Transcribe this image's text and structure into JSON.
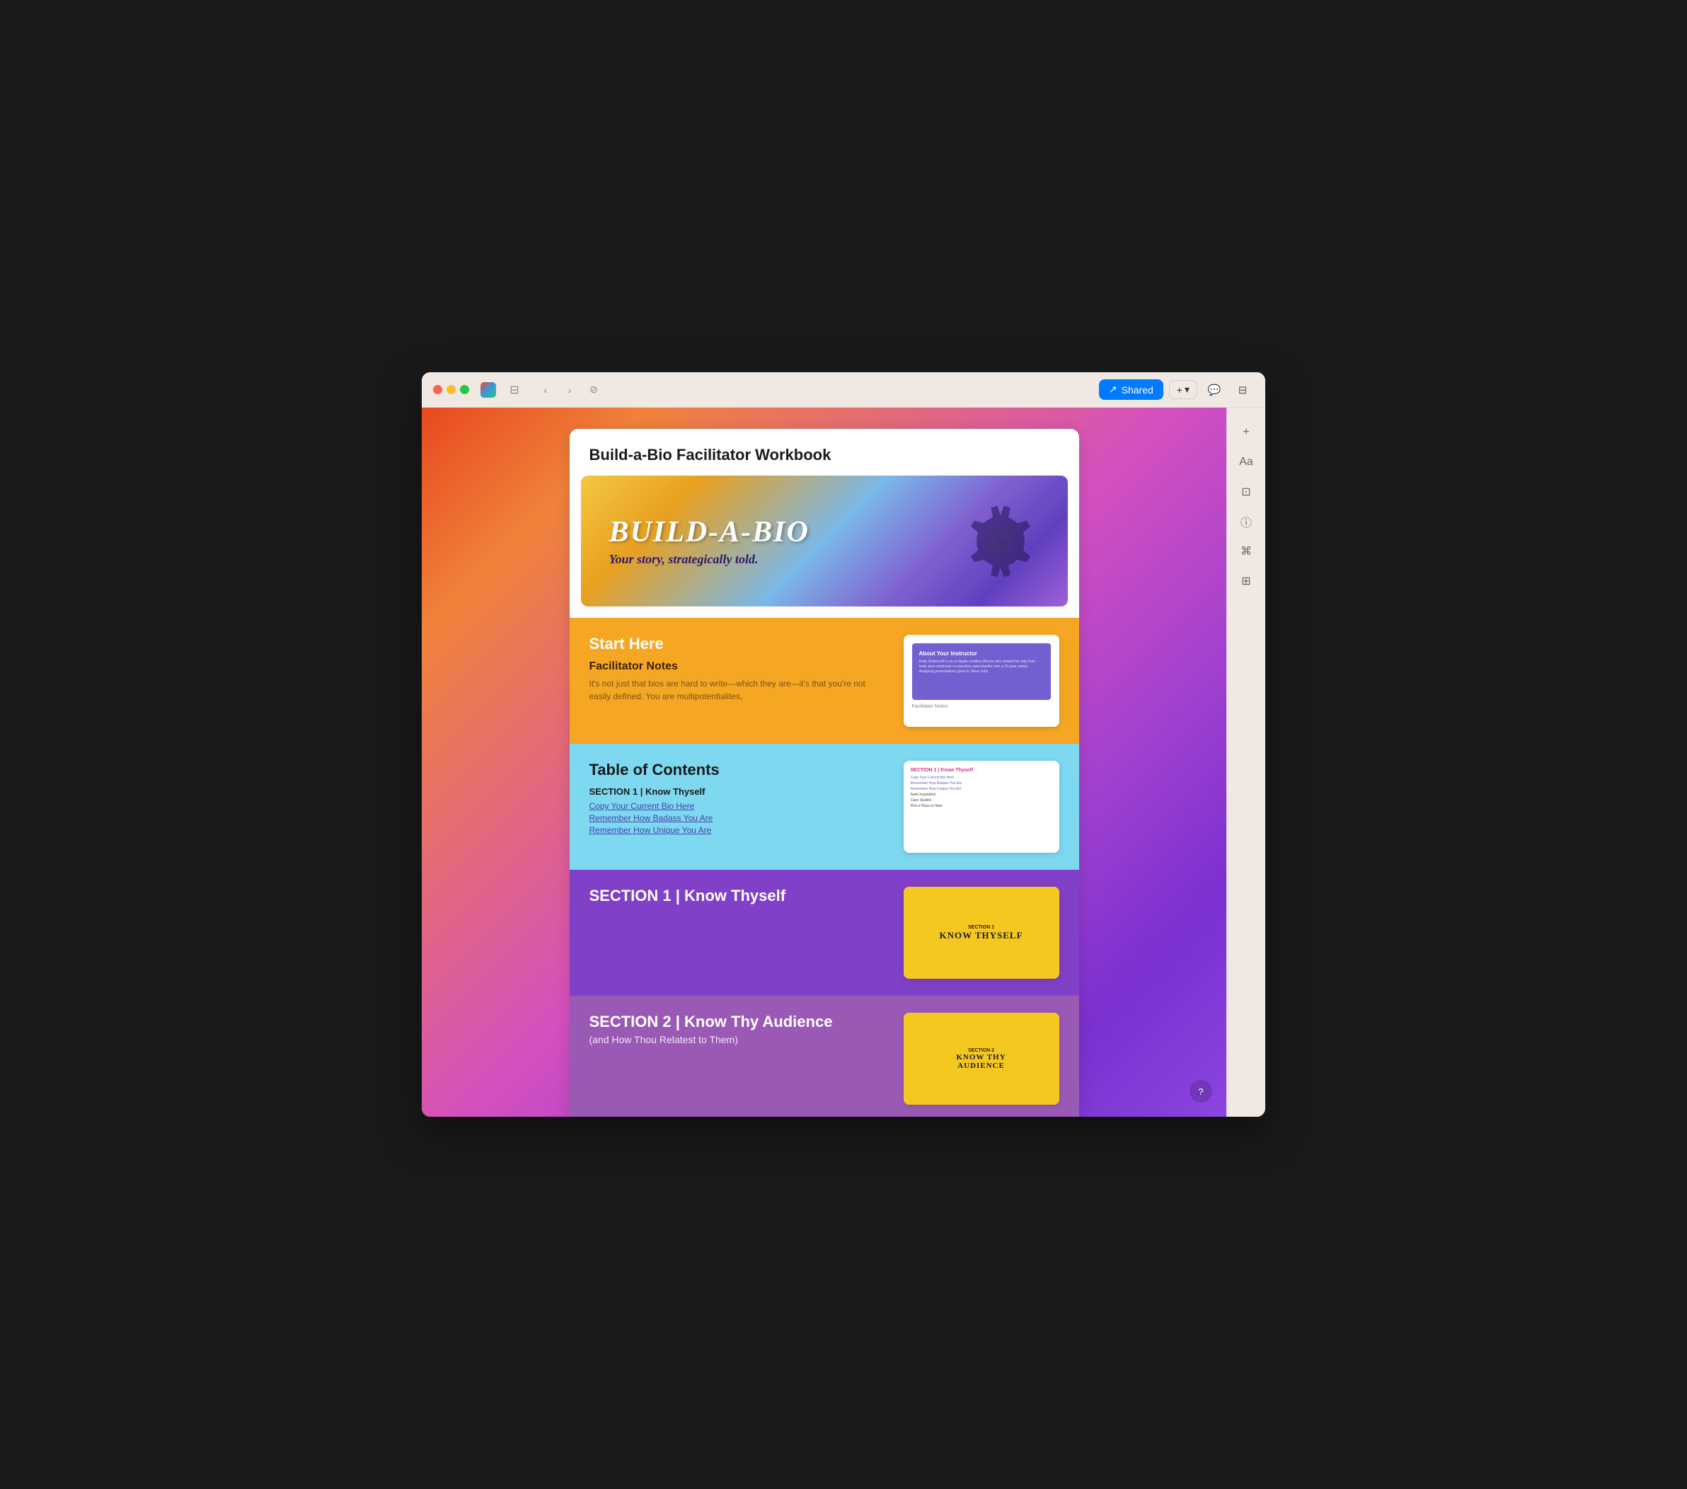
{
  "browser": {
    "shared_label": "Shared",
    "plus_label": "+",
    "chevron_label": "▾"
  },
  "document": {
    "title": "Build-a-Bio Facilitator Workbook",
    "hero": {
      "title": "BUILD-A-BIO",
      "subtitle": "Your story, strategically told."
    },
    "start_here": {
      "title": "Start Here",
      "notes_label": "Facilitator Notes",
      "notes_text": "It's not just that bios are hard to write—which they are—it's that you're not easily defined. You are multipotentialites,",
      "thumb_title": "About Your Instructor",
      "thumb_text": "Anita Stubenvoll is an ex-Apple creative director who worked her way from retail store employee to executive speechwriter over a 15-year career, designing presentations given to Steve Jobs.",
      "thumb_footer": "Facilitator Notes"
    },
    "toc": {
      "title": "Table of Contents",
      "section1_label": "SECTION 1 | Know Thyself",
      "items": [
        "Copy Your Current Bio Here",
        "Remember How Badass You Are",
        "Remember How Unique You Are"
      ],
      "thumb_section_label": "SECTION 1 | Know Thyself",
      "thumb_items": [
        "Copy Your Current Bio Here",
        "Remember How Badass You Are",
        "Remember How Unique You Are",
        "Seek Inspiration",
        "Case Studies",
        "Pick a Place to Start"
      ]
    },
    "section1": {
      "title": "SECTION 1 | Know Thyself",
      "thumb_label": "SECTION 1",
      "thumb_title": "KNOW THYSELF"
    },
    "section2": {
      "title": "SECTION 2 | Know Thy Audience",
      "subtitle": "(and How Thou Relatest to Them)",
      "thumb_label": "SECTION 2",
      "thumb_title": "KNOW THY\nAUDIENCE"
    }
  },
  "toolbar": {
    "plus_icon": "+",
    "font_icon": "Aa",
    "image_icon": "⊡",
    "info_icon": "ⓘ",
    "cmd_icon": "⌘",
    "grid_icon": "⊞"
  }
}
